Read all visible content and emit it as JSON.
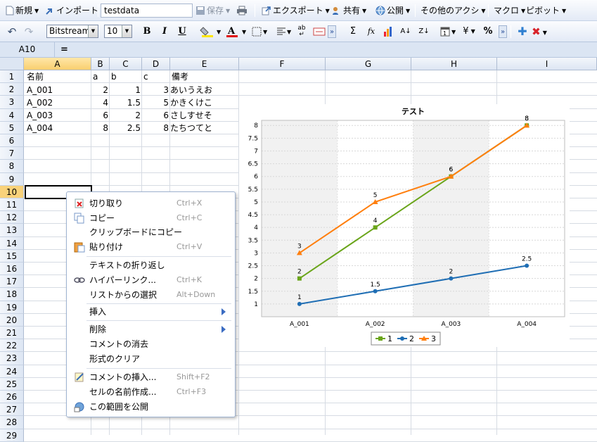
{
  "toolbar1": {
    "new_label": "新規",
    "import_label": "インポート",
    "doc_name": "testdata",
    "save_label": "保存",
    "export_label": "エクスポート",
    "share_label": "共有",
    "publish_label": "公開",
    "other_actions_label": "その他のアクシ",
    "macro_label": "マクロ",
    "pivot_label": "ピボット"
  },
  "toolbar2": {
    "font_family": "Bitstream",
    "font_size": "10",
    "bold": "B",
    "italic": "I",
    "underline": "U",
    "sum": "Σ",
    "fx": "fx",
    "currency": "¥",
    "percent": "%"
  },
  "formula_bar": {
    "cell_ref": "A10",
    "equals": "="
  },
  "columns": [
    "A",
    "B",
    "C",
    "D",
    "E",
    "F",
    "G",
    "H",
    "I"
  ],
  "rows": [
    "1",
    "2",
    "3",
    "4",
    "5",
    "6",
    "7",
    "8",
    "9",
    "10",
    "11",
    "12",
    "13",
    "14",
    "15",
    "16",
    "17",
    "18",
    "19",
    "20",
    "21",
    "22",
    "23",
    "24",
    "25",
    "26",
    "27",
    "28",
    "29"
  ],
  "active_cell": {
    "column": "A",
    "row": "10"
  },
  "cells": {
    "r1": {
      "a": "名前",
      "b": "a",
      "c": "b",
      "d": "c",
      "e": "備考"
    },
    "r2": {
      "a": "A_001",
      "b": "2",
      "c": "1",
      "d": "3",
      "e": "あいうえお"
    },
    "r3": {
      "a": "A_002",
      "b": "4",
      "c": "1.5",
      "d": "5",
      "e": "かきくけこ"
    },
    "r4": {
      "a": "A_003",
      "b": "6",
      "c": "2",
      "d": "6",
      "e": "さしすせそ"
    },
    "r5": {
      "a": "A_004",
      "b": "8",
      "c": "2.5",
      "d": "8",
      "e": "たちつてと"
    }
  },
  "chart_data": {
    "type": "line",
    "title": "テスト",
    "categories": [
      "A_001",
      "A_002",
      "A_003",
      "A_004"
    ],
    "series": [
      {
        "name": "1",
        "values": [
          2,
          4,
          6,
          8
        ],
        "color": "#6aa51a"
      },
      {
        "name": "2",
        "values": [
          1,
          1.5,
          2,
          2.5
        ],
        "color": "#1f6eb4"
      },
      {
        "name": "3",
        "values": [
          3,
          5,
          6,
          8
        ],
        "color": "#ff7f0e"
      }
    ],
    "ylim": [
      0.5,
      8.2
    ],
    "yticks": [
      "1",
      "1.5",
      "2",
      "2.5",
      "3",
      "3.5",
      "4",
      "4.5",
      "5",
      "5.5",
      "6",
      "6.5",
      "7",
      "7.5",
      "8"
    ],
    "grid": true,
    "legend": "bottom",
    "data_labels": true
  },
  "context_menu": {
    "items": [
      {
        "label": "切り取り",
        "shortcut": "Ctrl+X",
        "icon": "cut-icon"
      },
      {
        "label": "コピー",
        "shortcut": "Ctrl+C",
        "icon": "copy-icon"
      },
      {
        "label": "クリップボードにコピー",
        "shortcut": "",
        "icon": ""
      },
      {
        "label": "貼り付け",
        "shortcut": "Ctrl+V",
        "icon": "paste-icon"
      },
      {
        "label": "テキストの折り返し",
        "shortcut": "",
        "icon": ""
      },
      {
        "label": "ハイパーリンク...",
        "shortcut": "Ctrl+K",
        "icon": "link-icon"
      },
      {
        "label": "リストからの選択",
        "shortcut": "Alt+Down",
        "icon": ""
      },
      {
        "label": "挿入",
        "shortcut": "",
        "icon": ""
      },
      {
        "label": "削除",
        "shortcut": "",
        "icon": ""
      },
      {
        "label": "コメントの消去",
        "shortcut": "",
        "icon": ""
      },
      {
        "label": "形式のクリア",
        "shortcut": "",
        "icon": ""
      },
      {
        "label": "コメントの挿入...",
        "shortcut": "Shift+F2",
        "icon": "comment-icon"
      },
      {
        "label": "セルの名前作成...",
        "shortcut": "Ctrl+F3",
        "icon": ""
      },
      {
        "label": "この範囲を公開",
        "shortcut": "",
        "icon": "publish-range-icon"
      }
    ]
  }
}
